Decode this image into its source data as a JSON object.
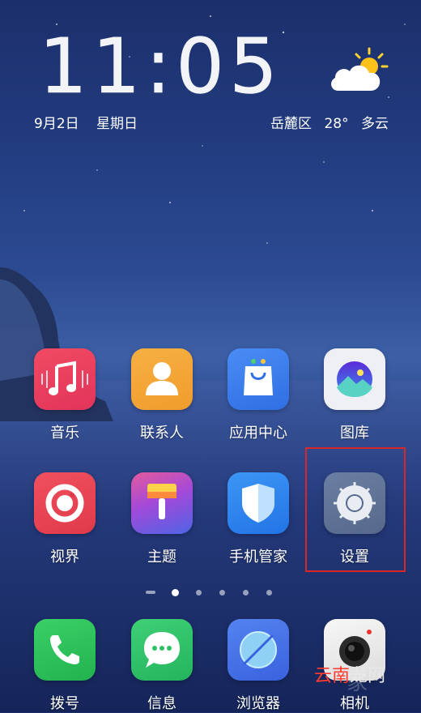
{
  "status": {
    "time": "11:05",
    "date": "9月2日",
    "weekday": "星期日",
    "location": "岳麓区",
    "temperature": "28°",
    "condition": "多云"
  },
  "apps_row1": [
    {
      "label": "音乐",
      "icon": "music-icon",
      "color": "#e84260"
    },
    {
      "label": "联系人",
      "icon": "contacts-icon",
      "color": "#f5a53a"
    },
    {
      "label": "应用中心",
      "icon": "app-store-icon",
      "color": "#3f7ff0"
    },
    {
      "label": "图库",
      "icon": "gallery-icon",
      "color": "#f1f3f7"
    }
  ],
  "apps_row2": [
    {
      "label": "视界",
      "icon": "vision-icon",
      "color": "#ea4454"
    },
    {
      "label": "主题",
      "icon": "theme-brush-icon",
      "color": "#b449d6"
    },
    {
      "label": "手机管家",
      "icon": "shield-icon",
      "color": "#2f86f2"
    },
    {
      "label": "设置",
      "icon": "settings-gear-icon",
      "color": "#5f7598"
    }
  ],
  "dock": [
    {
      "label": "拨号",
      "icon": "phone-icon",
      "color": "#2fc45d"
    },
    {
      "label": "信息",
      "icon": "message-icon",
      "color": "#33c06a"
    },
    {
      "label": "浏览器",
      "icon": "browser-icon",
      "color": "#4a74e8"
    },
    {
      "label": "相机",
      "icon": "camera-icon",
      "color": "#f2f2f2"
    }
  ],
  "pager": {
    "pages": 6,
    "current": 2
  },
  "watermark": {
    "text_a": "云南",
    "text_b": "龙网",
    "faint": "家"
  }
}
